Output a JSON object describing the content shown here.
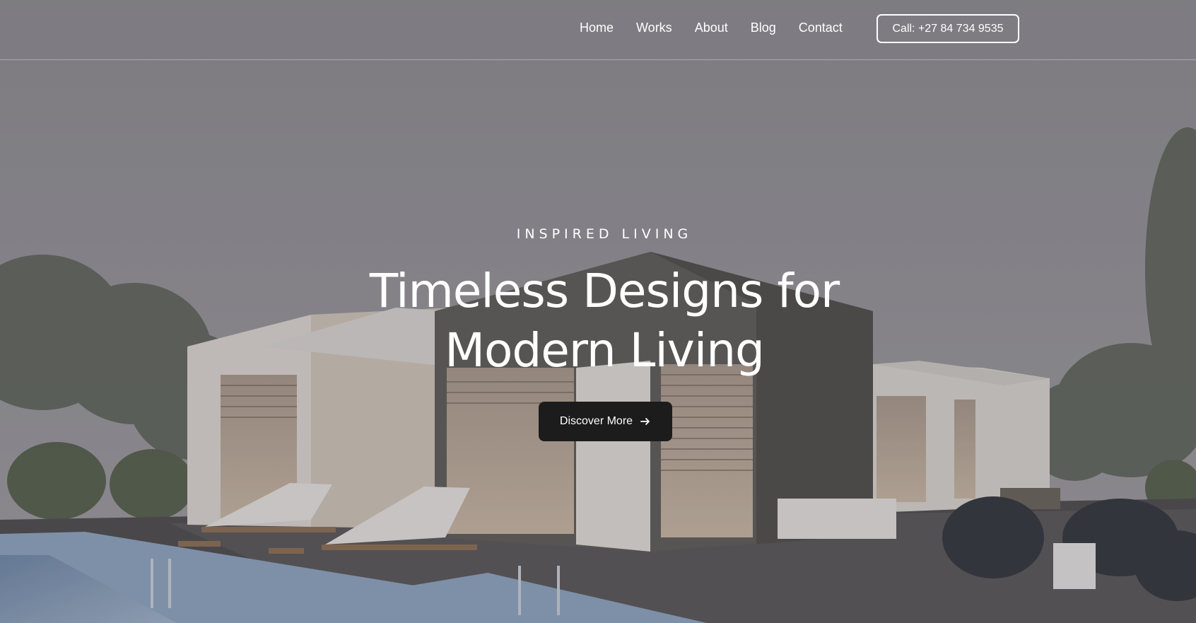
{
  "header": {
    "nav": [
      {
        "label": "Home"
      },
      {
        "label": "Works"
      },
      {
        "label": "About"
      },
      {
        "label": "Blog"
      },
      {
        "label": "Contact"
      }
    ],
    "call_label": "Call: +27 84 734 9535"
  },
  "hero": {
    "eyebrow": "INSPIRED LIVING",
    "headline_line1": "Timeless Designs for",
    "headline_line2": "Modern Living",
    "cta_label": "Discover More",
    "cta_icon": "arrow-right-icon",
    "background": "modern-house-pool-dusk"
  },
  "colors": {
    "overlay_sky": "#8f8d90",
    "button_dark": "#1c1c1d",
    "text": "#ffffff"
  }
}
